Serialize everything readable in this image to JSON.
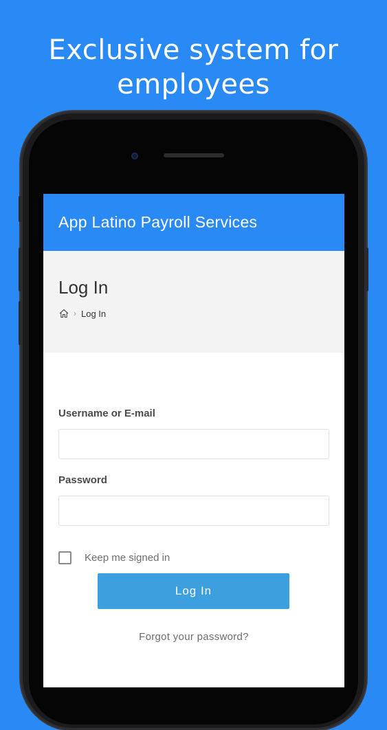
{
  "promo": {
    "line1": "Exclusive system for",
    "line2": "employees"
  },
  "app": {
    "title": "App Latino Payroll Services"
  },
  "page": {
    "title": "Log In",
    "breadcrumb_home_icon": "home-icon",
    "breadcrumb_current": "Log In"
  },
  "form": {
    "username_label": "Username or E-mail",
    "username_value": "",
    "password_label": "Password",
    "password_value": "",
    "remember_label": "Keep me signed in",
    "remember_checked": false,
    "submit_label": "Log In",
    "forgot_label": "Forgot your password?"
  },
  "colors": {
    "background": "#2a8af5",
    "header": "#2a8af5",
    "button": "#3e9fde",
    "page_head": "#f3f3f4"
  }
}
